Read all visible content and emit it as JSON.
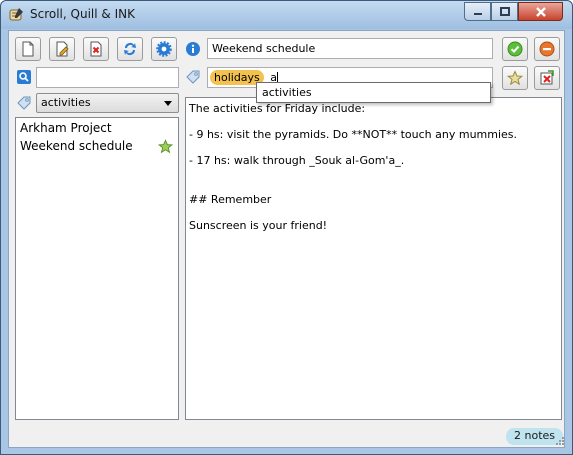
{
  "window": {
    "title": "Scroll, Quill & INK",
    "minimize_icon": "minimize-icon",
    "maximize_icon": "maximize-icon",
    "close_icon": "close-icon"
  },
  "toolbar": {
    "buttons": [
      {
        "name": "new-note",
        "icon": "new-document-icon"
      },
      {
        "name": "edit-note",
        "icon": "edit-document-icon"
      },
      {
        "name": "delete-note",
        "icon": "delete-document-icon"
      },
      {
        "name": "sync",
        "icon": "sync-icon"
      },
      {
        "name": "settings",
        "icon": "gear-icon"
      }
    ]
  },
  "note": {
    "title_value": "Weekend schedule",
    "save_icon": "check-icon",
    "cancel_icon": "minus-icon"
  },
  "search": {
    "value": "",
    "icon": "search-icon"
  },
  "tags": {
    "current_tags": [
      "holidays"
    ],
    "input_value": "a",
    "autocomplete": [
      "activities"
    ],
    "favorite_icon": "star-icon",
    "remove_icon": "delete-tag-icon"
  },
  "filter": {
    "selected": "activities",
    "icon": "tag-icon"
  },
  "notes": {
    "items": [
      {
        "title": "Arkham Project",
        "starred": false
      },
      {
        "title": "Weekend schedule",
        "starred": true
      }
    ]
  },
  "editor": {
    "lines": [
      "The activities for Friday include:",
      "",
      "- 9 hs: visit the pyramids. Do **NOT** touch any mummies.",
      "",
      "- 17 hs: walk through _Souk al-Gom'a_.",
      "",
      "",
      "## Remember",
      "",
      "Sunscreen is your friend!"
    ]
  },
  "status": {
    "count": "2 notes"
  },
  "colors": {
    "accent_tag": "#f2c14e",
    "status_badge": "#bfe3ef",
    "save_green": "#5cbf3a",
    "cancel_orange": "#e8762e"
  }
}
